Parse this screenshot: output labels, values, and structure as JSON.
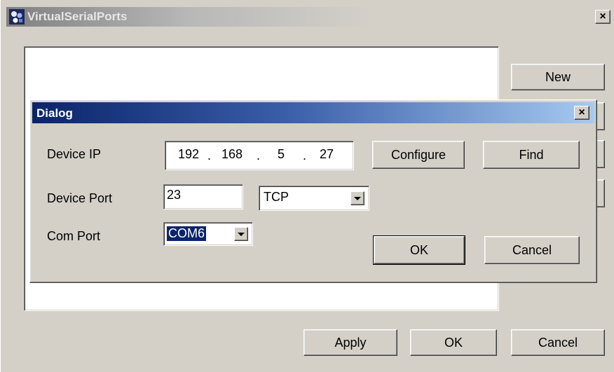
{
  "main_window": {
    "title": "VirtualSerialPorts",
    "close_glyph": "×",
    "side_buttons": {
      "new_label": "New"
    },
    "bottom_buttons": {
      "apply_label": "Apply",
      "ok_label": "OK",
      "cancel_label": "Cancel"
    }
  },
  "dialog": {
    "title": "Dialog",
    "close_glyph": "×",
    "device_ip": {
      "label": "Device IP",
      "octets": [
        "192",
        "168",
        "5",
        "27"
      ],
      "separator": "."
    },
    "device_port": {
      "label": "Device Port",
      "value": "23",
      "protocol": "TCP"
    },
    "com_port": {
      "label": "Com Port",
      "value": "COM6"
    },
    "buttons": {
      "configure_label": "Configure",
      "find_label": "Find",
      "ok_label": "OK",
      "cancel_label": "Cancel"
    }
  },
  "colors": {
    "dialog_title_start": "#0a246a",
    "dialog_title_end": "#a6caf0",
    "face": "#d4d0c8",
    "selection": "#0a246a"
  },
  "icons": {
    "app_icon": "app-icon",
    "close": "close-icon",
    "dropdown": "chevron-down-icon"
  }
}
